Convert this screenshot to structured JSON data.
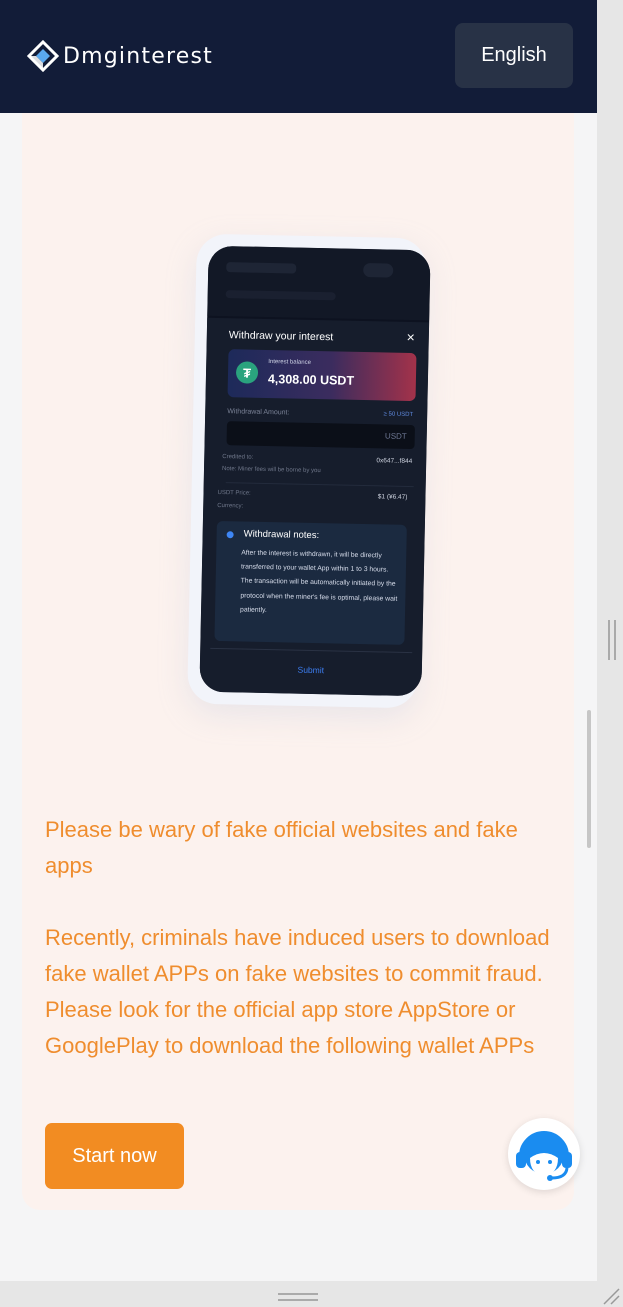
{
  "header": {
    "brand": "Dmginterest",
    "language_button": "English"
  },
  "phone_screen": {
    "modal_title": "Withdraw your interest",
    "close_symbol": "×",
    "balance_label": "Interest balance",
    "balance_value": "4,308.00 USDT",
    "withdrawal_amount_label": "Withdrawal Amount:",
    "withdrawal_min": "≥ 50 USDT",
    "amount_unit": "USDT",
    "credited_to_label": "Credited to:",
    "credited_to_value": "0x647...f844",
    "miner_fee_note": "Note: Miner fees will be borne by you",
    "usdt_price_label": "USDT Price:",
    "usdt_price_value": "$1 (¥6.47)",
    "currency_label": "Currency:",
    "notes_title": "Withdrawal notes:",
    "notes_body": "After the interest is withdrawn, it will be directly transferred to your wallet App within 1 to 3 hours. The transaction will be automatically initiated by the protocol when the miner's fee is optimal, please wait patiently.",
    "submit_label": "Submit"
  },
  "content": {
    "warning_title": "Please be wary of fake official websites and fake apps",
    "warning_body": "Recently, criminals have induced users to download fake wallet APPs on fake websites to commit fraud. Please look for the official app store AppStore or GooglePlay to download the following wallet APPs",
    "start_button": "Start now"
  },
  "colors": {
    "header_bg": "#121c38",
    "accent_orange": "#f28c22",
    "warning_text": "#ef8d2e",
    "card_bg": "#fcf2ee"
  },
  "icons": {
    "logo": "dmginterest-logo-icon",
    "support": "customer-support-headset-icon"
  }
}
